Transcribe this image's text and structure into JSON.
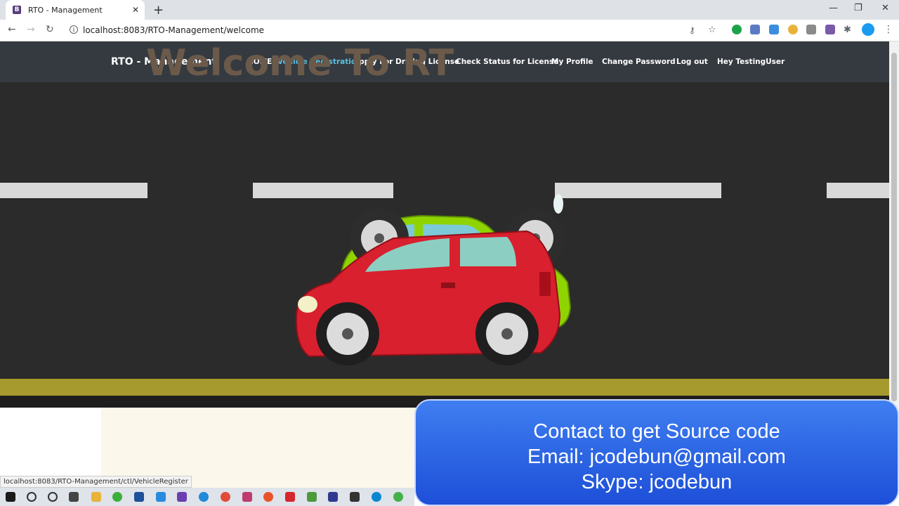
{
  "browser": {
    "tab_favicon": "B",
    "tab_title": "RTO - Management",
    "url": "localhost:8083/RTO-Management/welcome",
    "status_url": "localhost:8083/RTO-Management/ctl/VehicleRegister"
  },
  "navbar": {
    "brand": "RTO - Management",
    "links": [
      {
        "label": "HOME"
      },
      {
        "label": "Vehicle Registration"
      },
      {
        "label": "Apply For Driving License"
      },
      {
        "label": "Check Status for License"
      },
      {
        "label": "My Profile"
      },
      {
        "label": "Change Password"
      },
      {
        "label": "Log out"
      },
      {
        "label": "Hey TestingUser"
      }
    ]
  },
  "welcome": {
    "title": "Welcome To RT"
  },
  "contact": {
    "line1": "Contact to get Source code",
    "line2": "Email: jcodebun@gmail.com",
    "line3": "Skype: jcodebun"
  },
  "colors": {
    "navbar_bg": "#343a40",
    "active_link": "#5bc0de",
    "green_car": "#8fd400",
    "red_car": "#d8202e"
  }
}
